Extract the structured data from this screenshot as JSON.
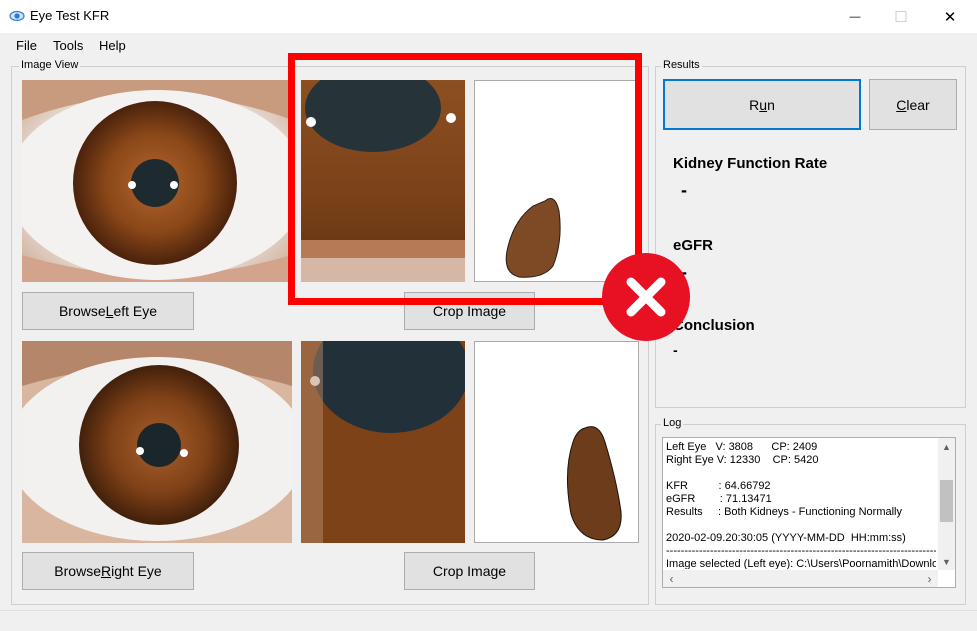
{
  "window": {
    "title": "Eye Test KFR",
    "minimize": "—",
    "maximize": "☐",
    "close": "✕"
  },
  "menu": {
    "file": "File",
    "tools": "Tools",
    "help": "Help"
  },
  "image_view": {
    "label": "Image View",
    "browse_left": {
      "pre": "Browse ",
      "accel": "L",
      "post": "eft Eye"
    },
    "browse_right": {
      "pre": "Browse ",
      "accel": "R",
      "post": "ight Eye"
    },
    "crop_top": "Crop Image",
    "crop_bottom": "Crop Image"
  },
  "results": {
    "label": "Results",
    "run": {
      "pre": "R",
      "accel": "u",
      "post": "n"
    },
    "clear": {
      "pre": "",
      "accel": "C",
      "post": "lear"
    },
    "kfr_heading": "Kidney Function Rate",
    "kfr_value": "-",
    "egfr_heading": "eGFR",
    "egfr_value": "-",
    "conclusion_heading": "Conclusion",
    "conclusion_value": "-"
  },
  "log": {
    "label": "Log",
    "lines": [
      "Left Eye   V: 3808      CP: 2409",
      "Right Eye V: 12330    CP: 5420",
      "",
      "KFR          : 64.66792",
      "eGFR        : 71.13471",
      "Results     : Both Kidneys - Functioning Normally",
      "",
      "2020-02-09.20:30:05 (YYYY-MM-DD  HH:mm:ss)",
      "----------------------------------------------------------------------------------",
      "Image selected (Left eye): C:\\Users\\Poornamith\\Downlo"
    ]
  },
  "overlay": {
    "mark": "✖",
    "accent": "#e81123",
    "frame_color": "#ff0000"
  }
}
